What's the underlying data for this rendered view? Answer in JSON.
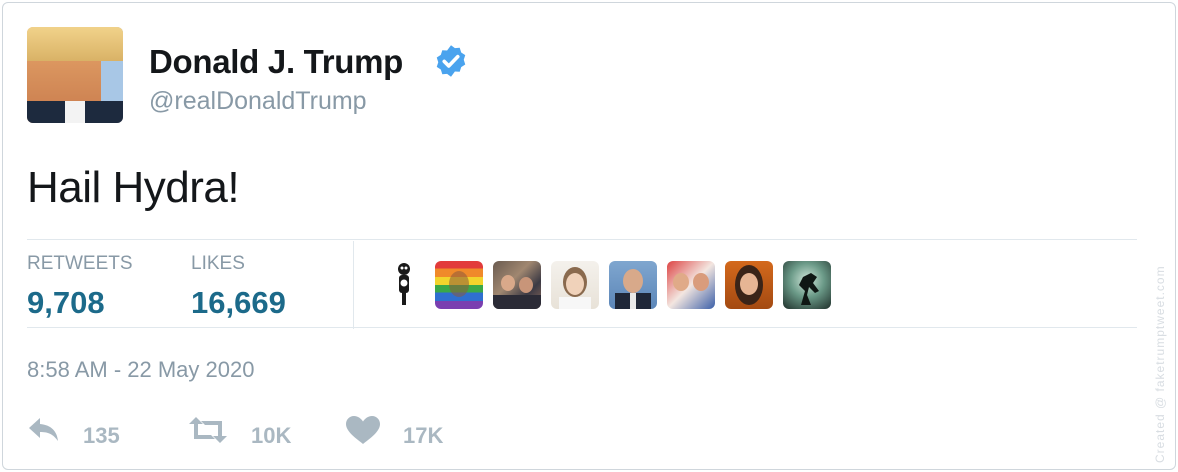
{
  "author": {
    "name": "Donald J. Trump",
    "handle": "@realDonaldTrump",
    "verified": true,
    "verified_color": "#4aa3ee"
  },
  "tweet": {
    "text": "Hail Hydra!"
  },
  "stats": {
    "retweets_label": "RETWEETS",
    "retweets_value": "9,708",
    "likes_label": "LIKES",
    "likes_value": "16,669",
    "value_color": "#1c6a8a"
  },
  "likers": [
    {
      "icon": "kit-cat-clock-avatar"
    },
    {
      "icon": "rainbow-flag-avatar"
    },
    {
      "icon": "crowd-photo-avatar"
    },
    {
      "icon": "woman-portrait-avatar"
    },
    {
      "icon": "man-in-suit-avatar"
    },
    {
      "icon": "two-people-avatar"
    },
    {
      "icon": "woman-dark-hair-avatar"
    },
    {
      "icon": "fighter-silhouette-avatar"
    }
  ],
  "timestamp": "8:58 AM - 22 May 2020",
  "actions": {
    "reply_icon": "reply-icon",
    "reply_count": "135",
    "retweet_icon": "retweet-icon",
    "retweet_count": "10K",
    "like_icon": "heart-icon",
    "like_count": "17K"
  },
  "watermark": "Created @ faketrumptweet.com"
}
